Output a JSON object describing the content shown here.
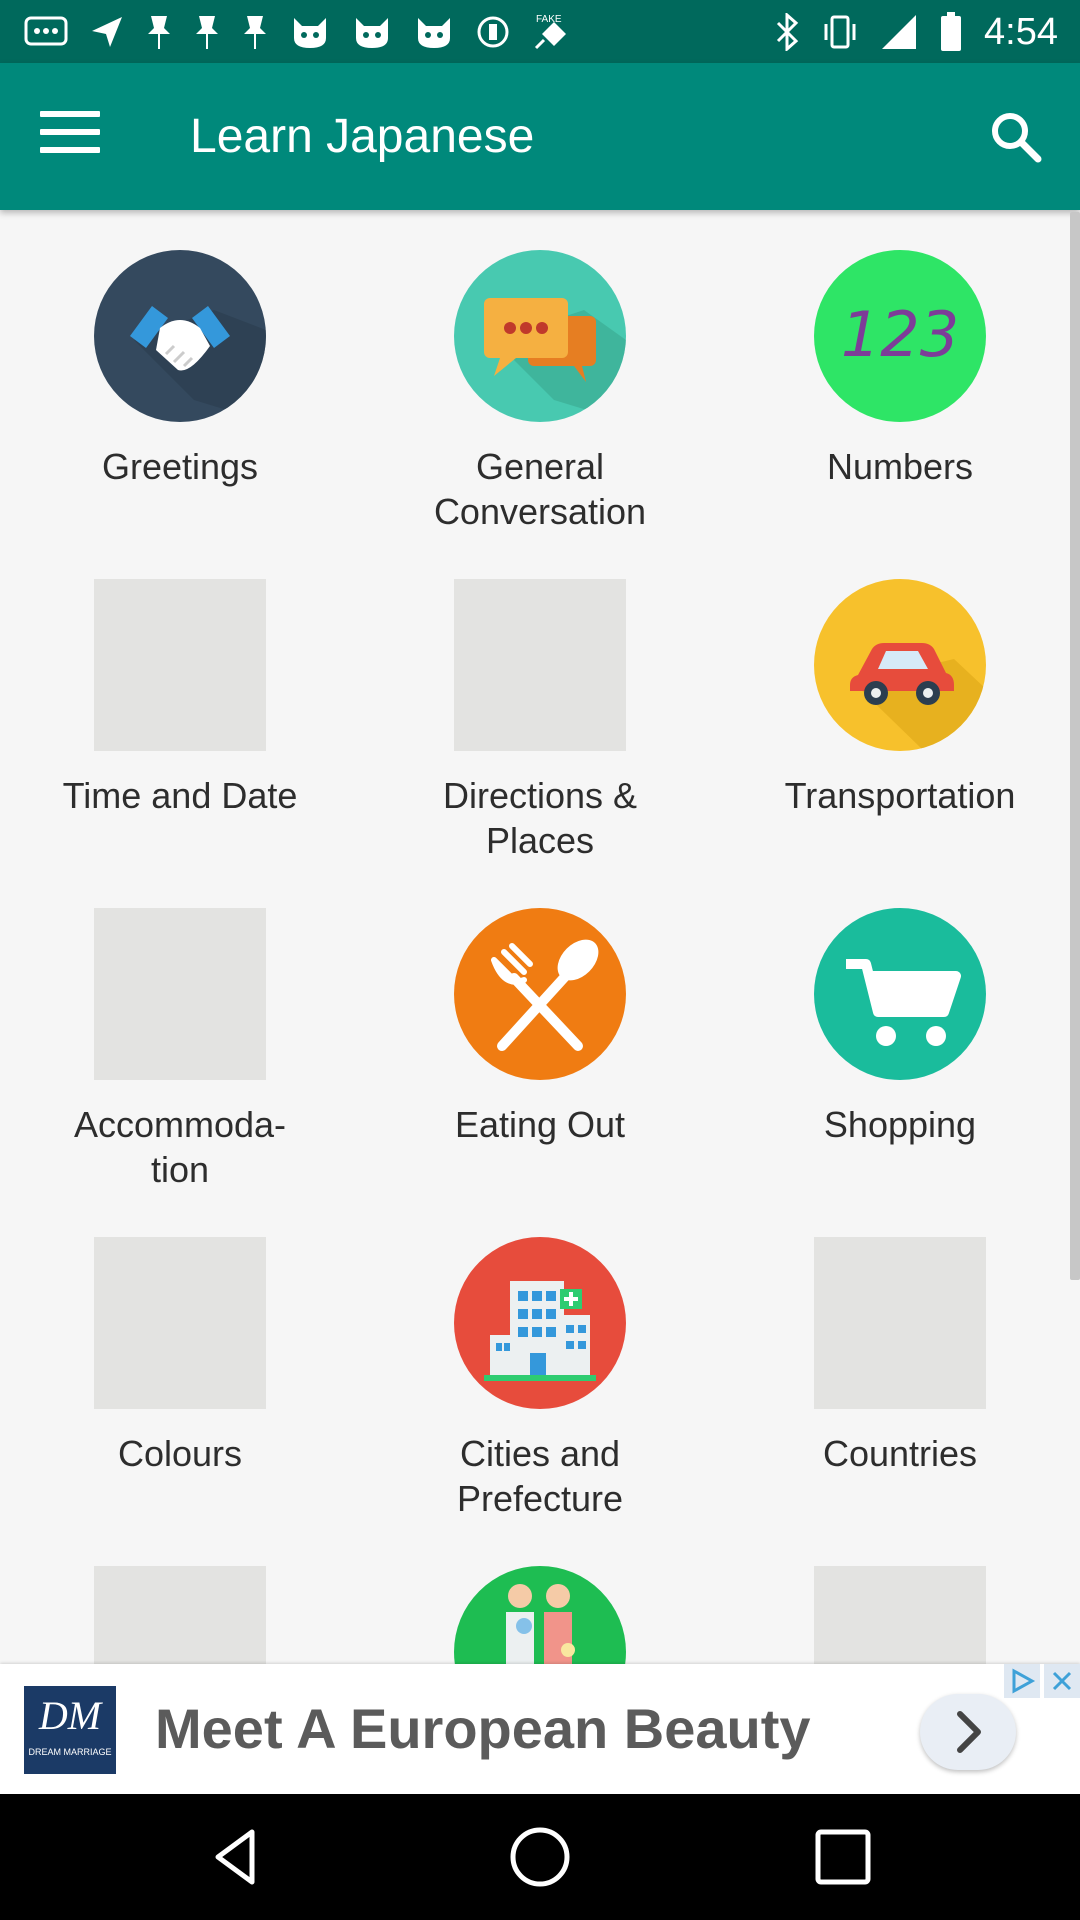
{
  "status_bar": {
    "time": "4:54",
    "left_icons": [
      "message-icon",
      "location-arrow-icon",
      "pin-icon",
      "pin-icon",
      "pin-icon",
      "cat-icon",
      "cat-icon",
      "cat-icon",
      "circle-icon",
      "satellite-icon"
    ],
    "fake_label": "FAKE"
  },
  "app_bar": {
    "title": "Learn Japanese",
    "colors": {
      "primary": "#00897b",
      "dark": "#00695c"
    }
  },
  "categories": [
    {
      "label": "Greetings",
      "icon": "handshake-icon"
    },
    {
      "label": "General\nConversation",
      "icon": "chat-bubbles-icon"
    },
    {
      "label": "Numbers",
      "icon": "numbers-123-icon"
    },
    {
      "label": "Time and Date",
      "icon": ""
    },
    {
      "label": "Directions &\nPlaces",
      "icon": ""
    },
    {
      "label": "Transportation",
      "icon": "car-icon"
    },
    {
      "label": "Accommoda-\ntion",
      "icon": ""
    },
    {
      "label": "Eating Out",
      "icon": "fork-spoon-icon"
    },
    {
      "label": "Shopping",
      "icon": "cart-icon"
    },
    {
      "label": "Colours",
      "icon": ""
    },
    {
      "label": "Cities and\nPrefecture",
      "icon": "city-building-icon"
    },
    {
      "label": "Countries",
      "icon": ""
    },
    {
      "label": "",
      "icon": ""
    },
    {
      "label": "",
      "icon": "family-icon"
    },
    {
      "label": "",
      "icon": ""
    }
  ],
  "numbers_glyph": "123",
  "ad": {
    "text": "Meet A European Beauty",
    "logo_mark": "DM",
    "logo_text": "DREAM MARRIAGE"
  }
}
